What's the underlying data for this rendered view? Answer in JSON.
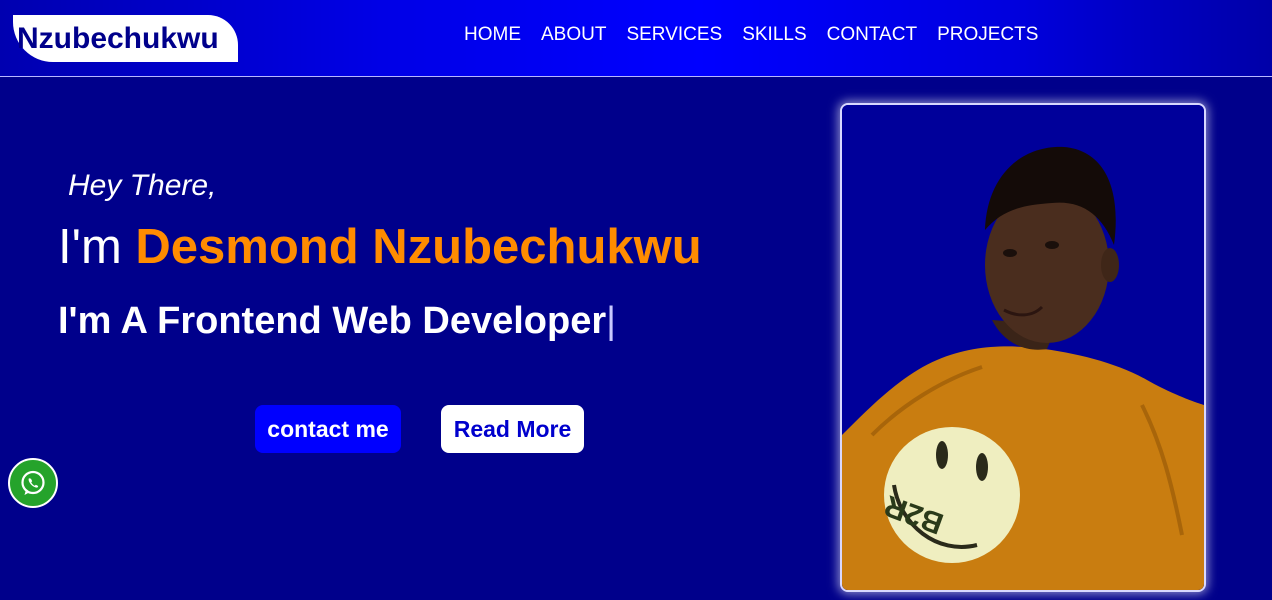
{
  "header": {
    "logo_text": "Nzubechukwu",
    "nav": [
      "HOME",
      "ABOUT",
      "SERVICES",
      "SKILLS",
      "CONTACT",
      "PROJECTS"
    ]
  },
  "hero": {
    "greeting": "Hey There,",
    "intro_prefix": "I'm ",
    "name": "Desmond Nzubechukwu",
    "role": "I'm A Frontend Web Developer",
    "cursor": "|",
    "contact_button": "contact me",
    "read_more_button": "Read More"
  },
  "photo": {
    "shirt_text": "B2R"
  },
  "colors": {
    "background": "#00008b",
    "accent": "#ff8c00",
    "header_blue": "#0000ff",
    "whatsapp_green": "#25a32b"
  },
  "icons": {
    "whatsapp": "whatsapp-icon"
  }
}
